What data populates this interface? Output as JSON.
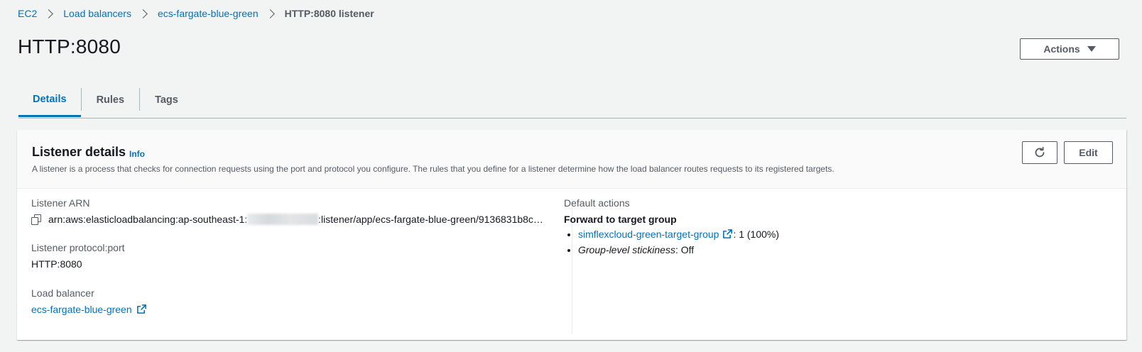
{
  "breadcrumb": {
    "items": [
      "EC2",
      "Load balancers",
      "ecs-fargate-blue-green"
    ],
    "current": "HTTP:8080 listener"
  },
  "page": {
    "title": "HTTP:8080"
  },
  "actions": {
    "label": "Actions"
  },
  "tabs": [
    {
      "label": "Details",
      "active": true
    },
    {
      "label": "Rules",
      "active": false
    },
    {
      "label": "Tags",
      "active": false
    }
  ],
  "panel": {
    "title": "Listener details",
    "info": "Info",
    "description": "A listener is a process that checks for connection requests using the port and protocol you configure. The rules that you define for a listener determine how the load balancer routes requests to its registered targets.",
    "edit_label": "Edit"
  },
  "details": {
    "arn_label": "Listener ARN",
    "arn_prefix": "arn:aws:elasticloadbalancing:ap-southeast-1:",
    "arn_suffix": ":listener/app/ecs-fargate-blue-green/9136831b8c…",
    "protocol_label": "Listener protocol:port",
    "protocol_value": "HTTP:8080",
    "lb_label": "Load balancer",
    "lb_value": "ecs-fargate-blue-green"
  },
  "default_actions": {
    "label": "Default actions",
    "heading": "Forward to target group",
    "target_group": "simflexcloud-green-target-group",
    "weight": ": 1 (100%)",
    "stickiness_label": "Group-level stickiness",
    "stickiness_value": ": Off"
  },
  "colors": {
    "link": "#0073bb",
    "text": "#16191f",
    "secondary": "#545b64",
    "background": "#f2f3f3"
  },
  "icons": [
    "chevron-right-icon",
    "caret-down-icon",
    "refresh-icon",
    "copy-icon",
    "external-link-icon"
  ]
}
